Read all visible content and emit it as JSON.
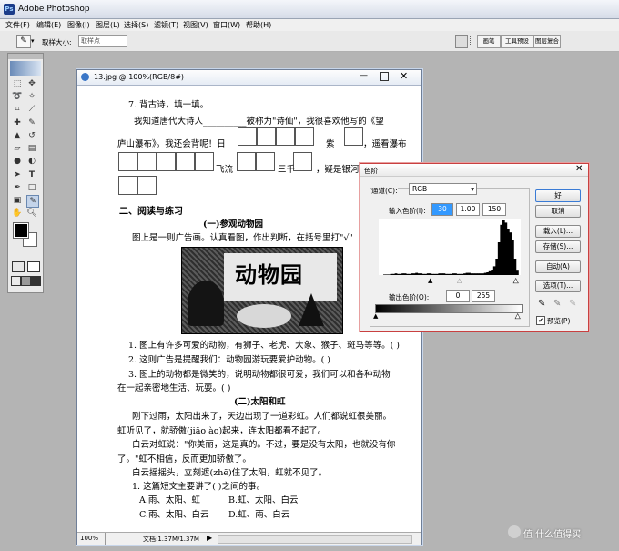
{
  "app": {
    "title": "Adobe Photoshop"
  },
  "menu": [
    "文件(F)",
    "编辑(E)",
    "图像(I)",
    "图层(L)",
    "选择(S)",
    "滤镜(T)",
    "视图(V)",
    "窗口(W)",
    "帮助(H)"
  ],
  "options": {
    "sample_label": "取样大小:",
    "sample_value": "取样点"
  },
  "panel_tabs": [
    "画笔",
    "工具预设",
    "图层复合"
  ],
  "document": {
    "title": "13.jpg @ 100%(RGB/8#)",
    "zoom": "100%",
    "status": "文档:1.37M/1.37M",
    "lines": [
      "7. 背古诗，填一填。",
      "我知道唐代大诗人__________被称为\"诗仙\"，我很喜欢他写的《望",
      "庐山瀑布》。我还会背呢！日",
      "紫",
      "，遥看瀑布",
      "飞流",
      "三千",
      "，疑是银河",
      "二、阅读与练习",
      "(一)参观动物园",
      "图上是一则广告画。认真看图，作出判断，在括号里打\"√\"",
      "1. 图上有许多可爱的动物，有狮子、老虎、大象、猴子、斑马等等。(  )",
      "2. 这则广告是提醒我们：动物园游玩要爱护动物。(  )",
      "3. 图上的动物都是微笑的，说明动物都很可爱，我们可以和各种动物",
      "在一起亲密地生活、玩耍。(  )",
      "(二)太阳和虹",
      "刚下过雨，太阳出来了，天边出现了一道彩虹。人们都说虹很美丽。",
      "虹听见了，就骄傲(jiāo ào)起来，连太阳都看不起了。",
      "白云对虹说：\"你美丽，这是真的。不过，要是没有太阳，也就没有你",
      "了。\"虹不相信，反而更加骄傲了。",
      "白云摇摇头，立刻遮(zhē)住了太阳，虹就不见了。",
      "1. 这篇短文主要讲了(    )之间的事。",
      "A.雨、太阳、虹",
      "B.虹、太阳、白云",
      "C.雨、太阳、白云",
      "D.虹、雨、白云"
    ],
    "poster_title": "动物园"
  },
  "levels": {
    "title": "色阶",
    "channel_label": "通道(C):",
    "channel_value": "RGB",
    "input_label": "输入色阶(I):",
    "input_values": [
      "30",
      "1.00",
      "150"
    ],
    "output_label": "输出色阶(O):",
    "output_values": [
      "0",
      "255"
    ],
    "buttons": [
      "好",
      "取消",
      "载入(L)...",
      "存储(S)...",
      "自动(A)",
      "选项(T)..."
    ],
    "preview_label": "预览(P)",
    "preview_checked": true,
    "histogram": [
      0,
      0,
      1,
      1,
      1,
      2,
      2,
      3,
      2,
      2,
      3,
      3,
      2,
      2,
      3,
      3,
      4,
      3,
      3,
      2,
      2,
      3,
      3,
      2,
      2,
      2,
      3,
      3,
      3,
      2,
      2,
      2,
      3,
      3,
      2,
      2,
      2,
      3,
      4,
      4,
      3,
      3,
      3,
      3,
      3,
      3,
      4,
      5,
      7,
      10,
      16,
      30,
      60,
      92,
      100,
      96,
      85,
      78,
      65,
      30,
      8,
      0
    ]
  },
  "watermark": "值 什么值得买"
}
